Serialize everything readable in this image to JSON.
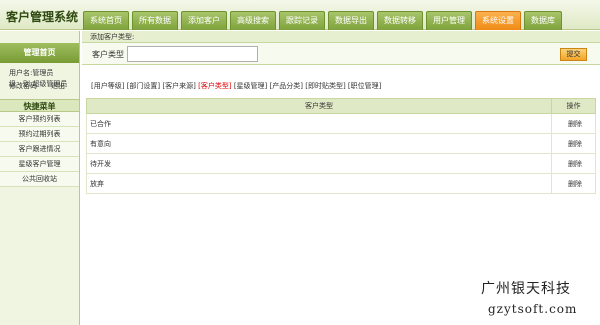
{
  "app": {
    "title": "客户管理系统"
  },
  "tabs": [
    {
      "label": "系统首页",
      "active": false
    },
    {
      "label": "所有数据",
      "active": false
    },
    {
      "label": "添加客户",
      "active": false
    },
    {
      "label": "高级搜索",
      "active": false
    },
    {
      "label": "跟踪记录",
      "active": false
    },
    {
      "label": "数据导出",
      "active": false
    },
    {
      "label": "数据转移",
      "active": false
    },
    {
      "label": "用户管理",
      "active": false
    },
    {
      "label": "系统设置",
      "active": true
    },
    {
      "label": "数据库",
      "active": false
    }
  ],
  "sidebar": {
    "header": "管理首页",
    "username_line": "用户名:管理员",
    "level_line": "级　别:超级管理员",
    "change_password": "修改密码",
    "logout": "退出",
    "menu_header": "快捷菜单",
    "menu_items": [
      "客户预约列表",
      "预约过期列表",
      "客户跟进情况",
      "星级客户管理",
      "公共回收站"
    ]
  },
  "main": {
    "section_title": "添加客户类型:",
    "form_label": "客户类型",
    "input_value": "",
    "submit_label": "提交",
    "settings_links": [
      {
        "label": "[用户等级]",
        "active": false
      },
      {
        "label": "[部门设置]",
        "active": false
      },
      {
        "label": "[客户来源]",
        "active": false
      },
      {
        "label": "[客户类型]",
        "active": true
      },
      {
        "label": "[星级管理]",
        "active": false
      },
      {
        "label": "[产品分类]",
        "active": false
      },
      {
        "label": "[即时贴类型]",
        "active": false
      },
      {
        "label": "[职位管理]",
        "active": false
      }
    ],
    "table": {
      "columns": [
        "客户类型",
        "操作"
      ],
      "rows": [
        {
          "type": "已合作",
          "action": "删除"
        },
        {
          "type": "有意向",
          "action": "删除"
        },
        {
          "type": "待开发",
          "action": "删除"
        },
        {
          "type": "放弃",
          "action": "删除"
        }
      ]
    }
  },
  "watermark": {
    "line1": "广州银天科技",
    "line2": "gzytsoft.com"
  },
  "colors": {
    "accent": "#f08a15",
    "header_green": "#789b35",
    "link_active": "#dd0000"
  }
}
